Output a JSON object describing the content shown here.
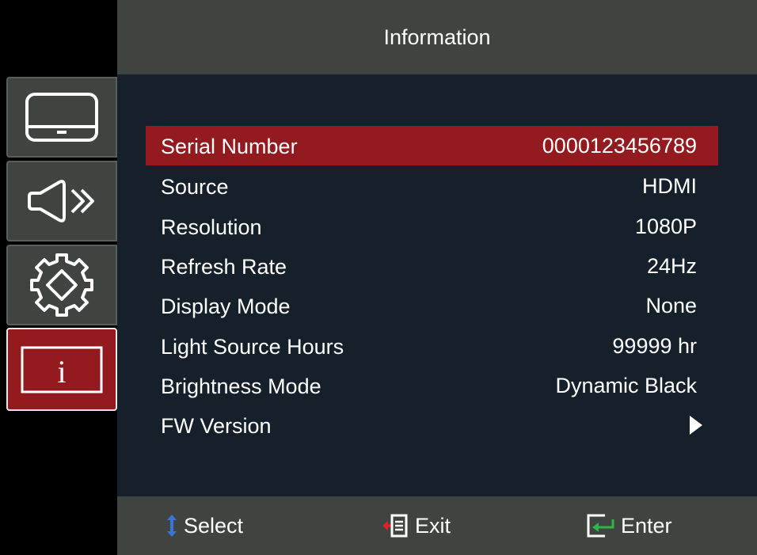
{
  "header": {
    "title": "Information"
  },
  "sidebar": {
    "items": [
      {
        "icon": "display-icon",
        "active": false
      },
      {
        "icon": "audio-icon",
        "active": false
      },
      {
        "icon": "settings-gear-icon",
        "active": false
      },
      {
        "icon": "info-icon",
        "glyph": "i",
        "active": true
      }
    ]
  },
  "rows": [
    {
      "label": "Serial Number",
      "value": "0000123456789",
      "selected": true
    },
    {
      "label": "Source",
      "value": "HDMI"
    },
    {
      "label": "Resolution",
      "value": "1080P"
    },
    {
      "label": "Refresh Rate",
      "value": "24Hz"
    },
    {
      "label": "Display Mode",
      "value": "None"
    },
    {
      "label": "Light Source Hours",
      "value": "99999 hr"
    },
    {
      "label": "Brightness Mode",
      "value": "Dynamic Black"
    },
    {
      "label": "FW Version",
      "value_icon": "arrow-right-icon"
    }
  ],
  "footer": {
    "select_label": "Select",
    "exit_label": "Exit",
    "enter_label": "Enter"
  },
  "colors": {
    "accent_red": "#931b20",
    "panel_gray": "#3f4441",
    "content_bg": "#16202a",
    "select_arrow_blue": "#3a74d9",
    "exit_arrow_red": "#e01f26",
    "enter_arrow_green": "#2fb34a"
  }
}
